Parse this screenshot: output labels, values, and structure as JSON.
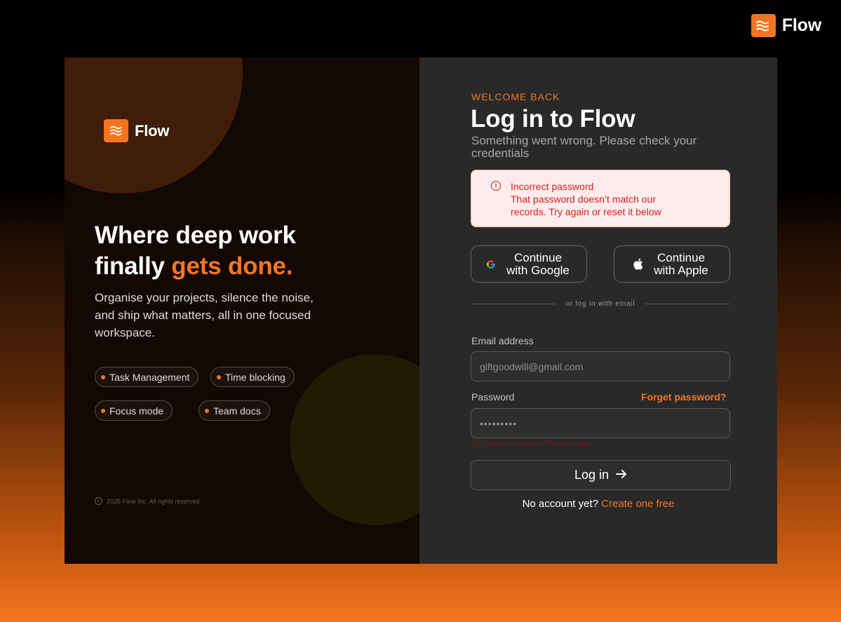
{
  "brand": {
    "name": "Flow",
    "accent": "#f47520",
    "logo_icon": "waves-icon"
  },
  "hero": {
    "headline_line1": "Where deep work",
    "headline_line2_prefix": "finally ",
    "headline_accent": "gets done.",
    "subcopy": "Organise your projects, silence the noise, and ship what matters, all in one focused workspace.",
    "chips": [
      "Task Management",
      "Time blocking",
      "Focus mode",
      "Team docs"
    ],
    "copyright": "2026 Flow Inc. All rights reserved"
  },
  "form": {
    "eyebrow": "WELCOME BACK",
    "title": "Log in to Flow",
    "subtitle": "Something went wrong. Please check your credentials",
    "alert": {
      "title": "Incorrect password",
      "body": "That password doesn’t match our records. Try again or reset it below",
      "icon": "alert-circle-icon",
      "color": "#d32121"
    },
    "social": {
      "google_label": "Continue with Google",
      "apple_label": "Continue with Apple"
    },
    "divider_text": "or log in with email",
    "email": {
      "label": "Email address",
      "value": "giftgoodwill@gmail.com"
    },
    "password": {
      "label": "Password",
      "value": "•••••••••",
      "forgot_label": "Forget password?",
      "error": "Password is incorrect. Please try again"
    },
    "submit_label": "Log in",
    "submit_icon": "arrow-right-icon",
    "signup_prompt": "No account yet?",
    "signup_link": "Create one free"
  }
}
